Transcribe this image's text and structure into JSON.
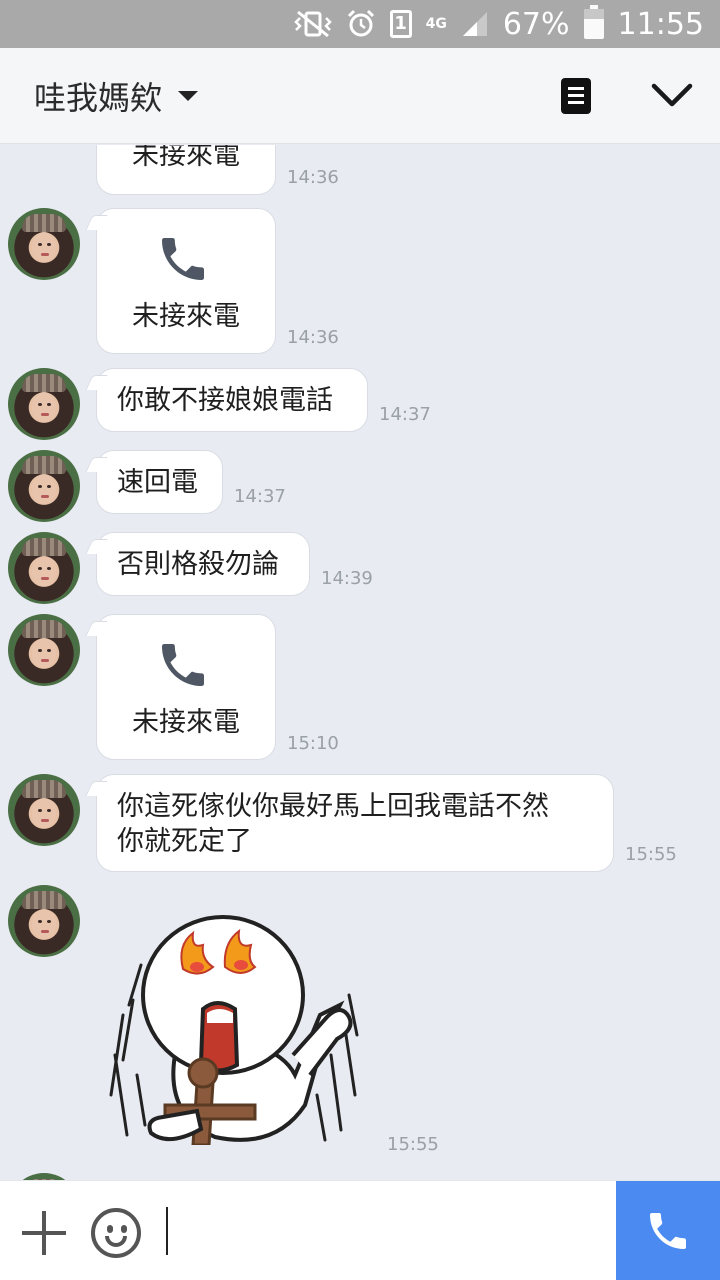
{
  "status_bar": {
    "battery_percent": "67%",
    "time": "11:55",
    "sim_slot": "1",
    "network": "4G",
    "icons": [
      "vibrate-off-icon",
      "alarm-icon",
      "sim-icon",
      "signal-icon",
      "battery-icon"
    ]
  },
  "header": {
    "title": "哇我媽欸",
    "icons": [
      "dropdown-caret-icon",
      "notes-icon",
      "chevron-down-icon"
    ]
  },
  "messages": [
    {
      "type": "missed_call",
      "text": "未接來電",
      "time": "14:36"
    },
    {
      "type": "missed_call",
      "text": "未接來電",
      "time": "14:36"
    },
    {
      "type": "text",
      "text": "你敢不接娘娘電話",
      "time": "14:37"
    },
    {
      "type": "text",
      "text": "速回電",
      "time": "14:37"
    },
    {
      "type": "text",
      "text": "否則格殺勿論",
      "time": "14:39"
    },
    {
      "type": "missed_call",
      "text": "未接來電",
      "time": "15:10"
    },
    {
      "type": "text",
      "lines": [
        "你這死傢伙你最好馬上回我電話不然",
        "你就死定了"
      ],
      "time": "15:55"
    },
    {
      "type": "sticker",
      "description_icon": "angry-voodoo-sticker",
      "time": "15:55"
    }
  ],
  "input_bar": {
    "placeholder": "",
    "icons": [
      "plus-icon",
      "emoji-icon",
      "phone-icon"
    ]
  },
  "colors": {
    "chat_background": "#e8ebf1",
    "call_button": "#4a8af1",
    "status_bar": "#a9a9a9"
  }
}
